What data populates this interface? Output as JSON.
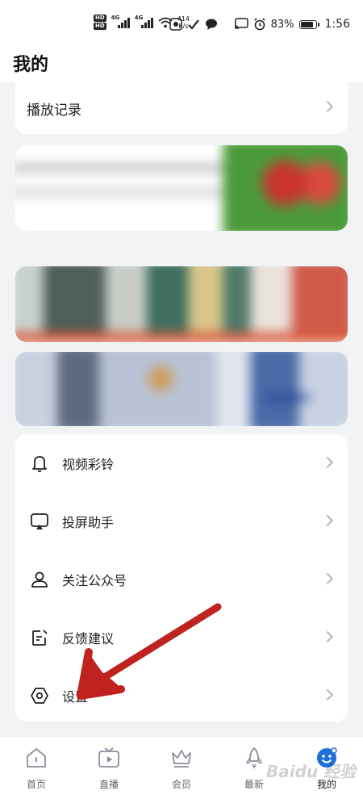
{
  "status_bar": {
    "hd_badge": "HD",
    "network_1": "4G",
    "network_2": "4G",
    "speed_value": "414",
    "speed_unit": "K/s",
    "battery": "83%",
    "time": "1:56"
  },
  "header": {
    "title": "我的"
  },
  "history": {
    "label": "播放记录"
  },
  "menu": [
    {
      "label": "视频彩铃",
      "icon": "bell-icon"
    },
    {
      "label": "投屏助手",
      "icon": "cast-screen-icon"
    },
    {
      "label": "关注公众号",
      "icon": "person-icon"
    },
    {
      "label": "反馈建议",
      "icon": "feedback-icon"
    },
    {
      "label": "设置",
      "icon": "settings-icon"
    }
  ],
  "bottom_nav": [
    {
      "label": "首页",
      "icon": "home-icon"
    },
    {
      "label": "直播",
      "icon": "tv-icon"
    },
    {
      "label": "会员",
      "icon": "crown-icon"
    },
    {
      "label": "最新",
      "icon": "rocket-icon"
    },
    {
      "label": "我的",
      "icon": "profile-face-icon",
      "active": true
    }
  ],
  "watermark": "Baidu 经验",
  "colors": {
    "accent": "#1e6fd9",
    "arrow": "#c0231f",
    "background": "#f2f3f5"
  }
}
